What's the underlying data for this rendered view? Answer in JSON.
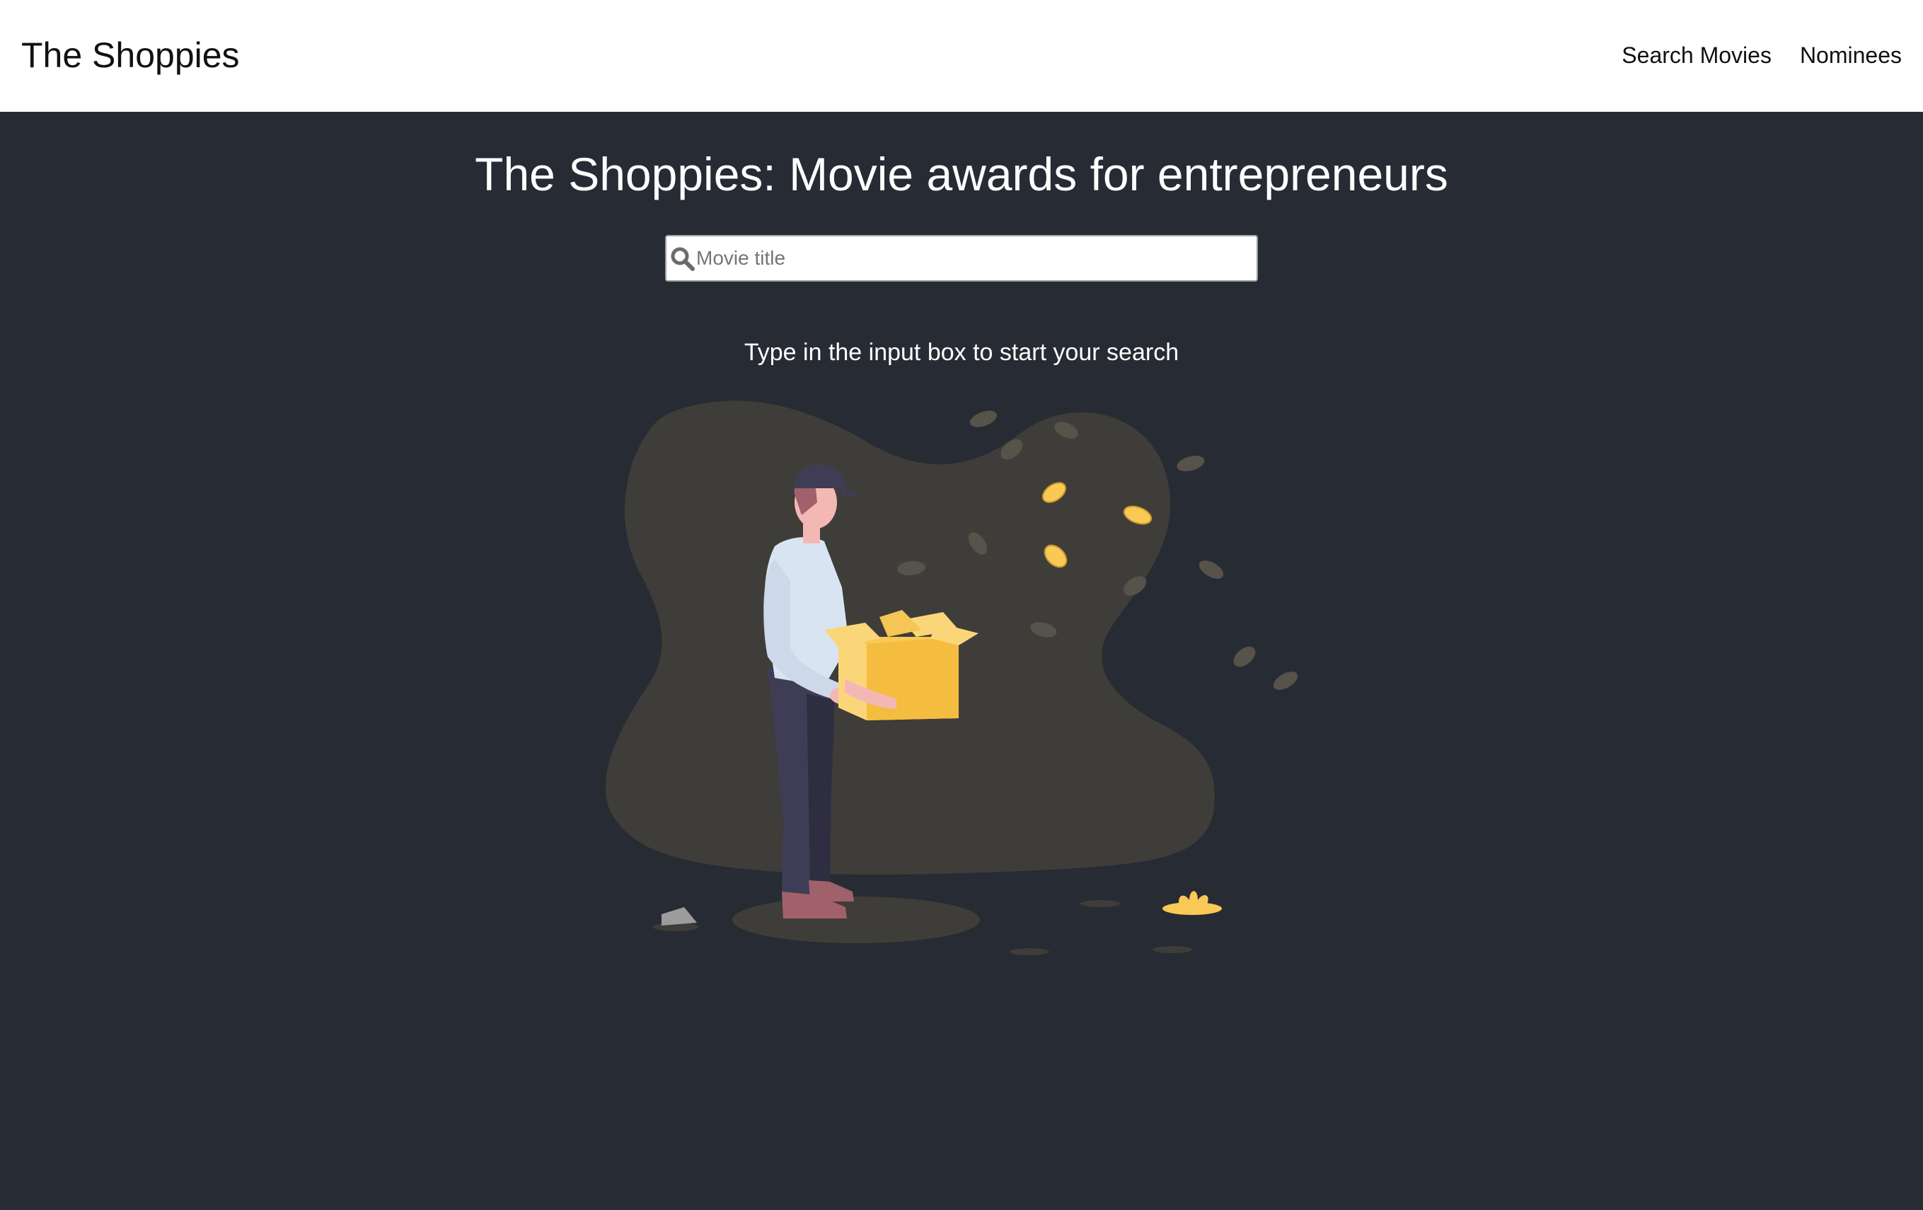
{
  "navbar": {
    "brand": "The Shoppies",
    "links": [
      {
        "label": "Search Movies"
      },
      {
        "label": "Nominees"
      }
    ]
  },
  "main": {
    "title": "The Shoppies: Movie awards for entrepreneurs",
    "search": {
      "placeholder": "Movie title",
      "value": "",
      "icon": "search-icon"
    },
    "hint": "Type in the input box to start your search",
    "illustration": {
      "icon": "person-holding-open-box-illustration"
    }
  },
  "colors": {
    "navbar_bg": "#ffffff",
    "page_bg": "#272b33",
    "blob": "#3f3d39",
    "accent_yellow": "#f9c855",
    "text_on_dark": "#ffffff"
  }
}
